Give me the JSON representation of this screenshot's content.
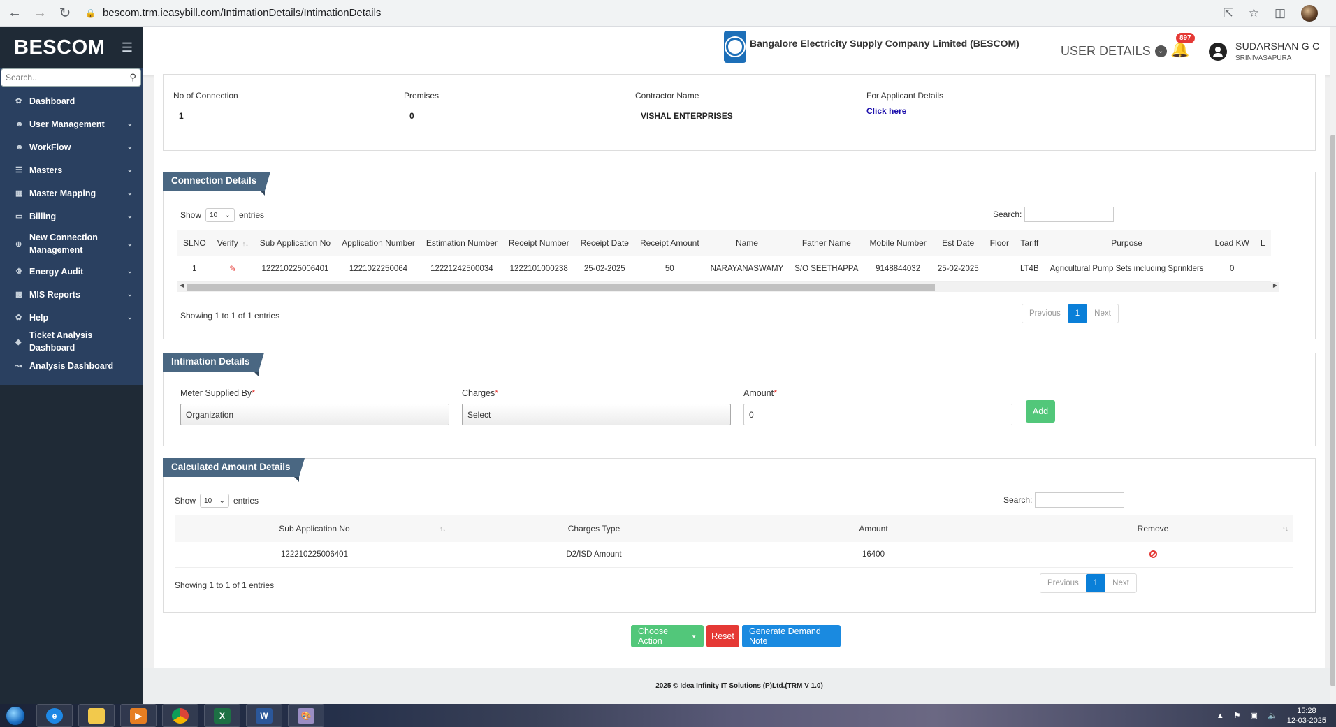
{
  "browser": {
    "url": "bescom.trm.ieasybill.com/IntimationDetails/IntimationDetails"
  },
  "sidebar": {
    "brand": "BESCOM",
    "search_placeholder": "Search..",
    "items": [
      {
        "label": "Dashboard",
        "icon": "palette-icon",
        "caret": false
      },
      {
        "label": "User Management",
        "icon": "user-icon",
        "caret": true
      },
      {
        "label": "WorkFlow",
        "icon": "user-icon",
        "caret": true
      },
      {
        "label": "Masters",
        "icon": "list-icon",
        "caret": true
      },
      {
        "label": "Master Mapping",
        "icon": "sitemap-icon",
        "caret": true
      },
      {
        "label": "Billing",
        "icon": "monitor-icon",
        "caret": true
      },
      {
        "label": "New Connection Management",
        "icon": "plus-circle-icon",
        "caret": true
      },
      {
        "label": "Energy Audit",
        "icon": "gears-icon",
        "caret": true
      },
      {
        "label": "MIS Reports",
        "icon": "bar-chart-icon",
        "caret": true
      },
      {
        "label": "Help",
        "icon": "palette-icon",
        "caret": true
      },
      {
        "label": "Ticket Analysis Dashboard",
        "icon": "diamond-icon",
        "caret": false
      },
      {
        "label": "Analysis Dashboard",
        "icon": "line-chart-icon",
        "caret": false
      }
    ]
  },
  "header": {
    "company": "Bangalore Electricity Supply Company Limited (BESCOM)",
    "user_details": "USER DETAILS",
    "notification_count": "897",
    "user_name": "SUDARSHAN G C",
    "user_location": "SRINIVASAPURA"
  },
  "summary": {
    "no_of_connection_label": "No of Connection",
    "no_of_connection": "1",
    "premises_label": "Premises",
    "premises": "0",
    "contractor_label": "Contractor Name",
    "contractor": "VISHAL ENTERPRISES",
    "applicant_label": "For Applicant Details",
    "applicant_link": "Click here"
  },
  "connection": {
    "title": "Connection Details",
    "show": "Show",
    "entries": "entries",
    "page_size": "10",
    "search_label": "Search:",
    "columns": [
      "SLNO",
      "Verify",
      "Sub Application No",
      "Application Number",
      "Estimation Number",
      "Receipt Number",
      "Receipt Date",
      "Receipt Amount",
      "Name",
      "Father Name",
      "Mobile Number",
      "Est Date",
      "Floor",
      "Tariff",
      "Purpose",
      "Load KW",
      "L"
    ],
    "row": {
      "slno": "1",
      "sub_app": "122210225006401",
      "app_no": "1221022250064",
      "est_no": "12221242500034",
      "receipt_no": "1222101000238",
      "receipt_date": "25-02-2025",
      "receipt_amount": "50",
      "name": "NARAYANASWAMY",
      "father": "S/O SEETHAPPA",
      "mobile": "9148844032",
      "est_date": "25-02-2025",
      "floor": "",
      "tariff": "LT4B",
      "purpose": "Agricultural Pump Sets including Sprinklers",
      "load": "0"
    },
    "showing": "Showing 1 to 1 of 1 entries",
    "prev": "Previous",
    "page": "1",
    "next": "Next"
  },
  "intimation": {
    "title": "Intimation Details",
    "meter_label": "Meter Supplied By",
    "meter_value": "Organization",
    "charges_label": "Charges",
    "charges_value": "Select",
    "amount_label": "Amount",
    "amount_value": "0",
    "add": "Add",
    "required_mark": "*"
  },
  "calculated": {
    "title": "Calculated Amount Details",
    "show": "Show",
    "entries": "entries",
    "page_size": "10",
    "search_label": "Search:",
    "columns": [
      "Sub Application No",
      "Charges Type",
      "Amount",
      "Remove"
    ],
    "row": {
      "sub_app": "122210225006401",
      "charges_type": "D2/ISD Amount",
      "amount": "16400"
    },
    "showing": "Showing 1 to 1 of 1 entries",
    "prev": "Previous",
    "page": "1",
    "next": "Next"
  },
  "actions": {
    "choose": "Choose Action",
    "reset": "Reset",
    "generate": "Generate Demand Note"
  },
  "footer": "2025 © Idea Infinity IT Solutions (P)Ltd.(TRM V 1.0)",
  "taskbar": {
    "time": "15:28",
    "date": "12-03-2025"
  }
}
